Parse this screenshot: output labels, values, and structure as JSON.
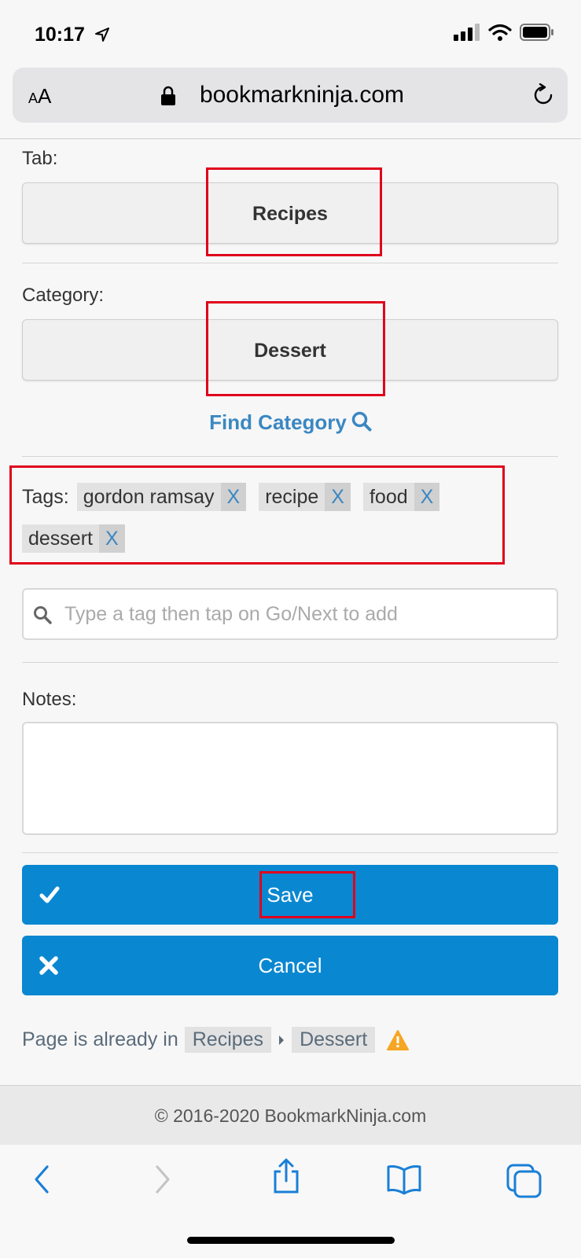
{
  "status": {
    "time": "10:17"
  },
  "browser": {
    "aa_small": "A",
    "aa_big": "A",
    "url": "bookmarkninja.com"
  },
  "form": {
    "tab_label": "Tab:",
    "tab_value": "Recipes",
    "category_label": "Category:",
    "category_value": "Dessert",
    "find_category": "Find Category",
    "tags_label": "Tags:",
    "tags": [
      {
        "name": "gordon ramsay",
        "remove": "X"
      },
      {
        "name": "recipe",
        "remove": "X"
      },
      {
        "name": "food",
        "remove": "X"
      },
      {
        "name": "dessert",
        "remove": "X"
      }
    ],
    "tag_placeholder": "Type a tag then tap on Go/Next to add",
    "notes_label": "Notes:",
    "save_label": "Save",
    "cancel_label": "Cancel",
    "already_text": "Page is already in",
    "already_tab": "Recipes",
    "already_category": "Dessert"
  },
  "footer": {
    "copyright": "© 2016-2020 BookmarkNinja.com"
  },
  "colors": {
    "accent": "#0a87d1",
    "link": "#3a87c2",
    "highlight": "#e0001b",
    "warning": "#f5a623"
  }
}
